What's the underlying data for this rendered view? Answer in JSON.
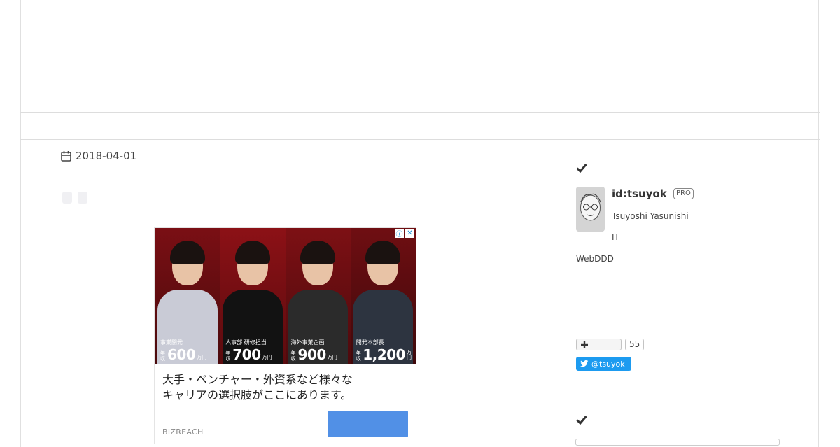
{
  "entry": {
    "date": "2018-04-01"
  },
  "ad": {
    "panels": [
      {
        "role": "事業開発",
        "nen": "年収",
        "salary": "600",
        "unit": "万円"
      },
      {
        "role": "人事部 研修担当",
        "nen": "年収",
        "salary": "700",
        "unit": "万円"
      },
      {
        "role": "海外事業企画",
        "nen": "年収",
        "salary": "900",
        "unit": "万円"
      },
      {
        "role": "開発本部長",
        "nen": "年収",
        "salary": "1,200",
        "unit": "万円"
      }
    ],
    "copy": "大手・ベンチャー・外資系など様々な\nキャリアの選択肢がここにあります。",
    "brand": "BIZREACH",
    "info_glyph": "ⓘ",
    "close_glyph": "✕"
  },
  "profile": {
    "id": "id:tsuyok",
    "badge": "PRO",
    "name": "Tsuyoshi Yasunishi",
    "line1": "IT",
    "line2": "WebDDD",
    "follow_icon": "plus-icon",
    "follow_count": "55",
    "twitter_handle": "@tsuyok"
  },
  "icons": {
    "date": "calendar-icon",
    "section": "check-icon",
    "twitter": "twitter-bird-icon"
  },
  "colors": {
    "twitter": "#1d9bf0",
    "cta": "#5190e6",
    "ad_bg": "#7a0f14"
  }
}
